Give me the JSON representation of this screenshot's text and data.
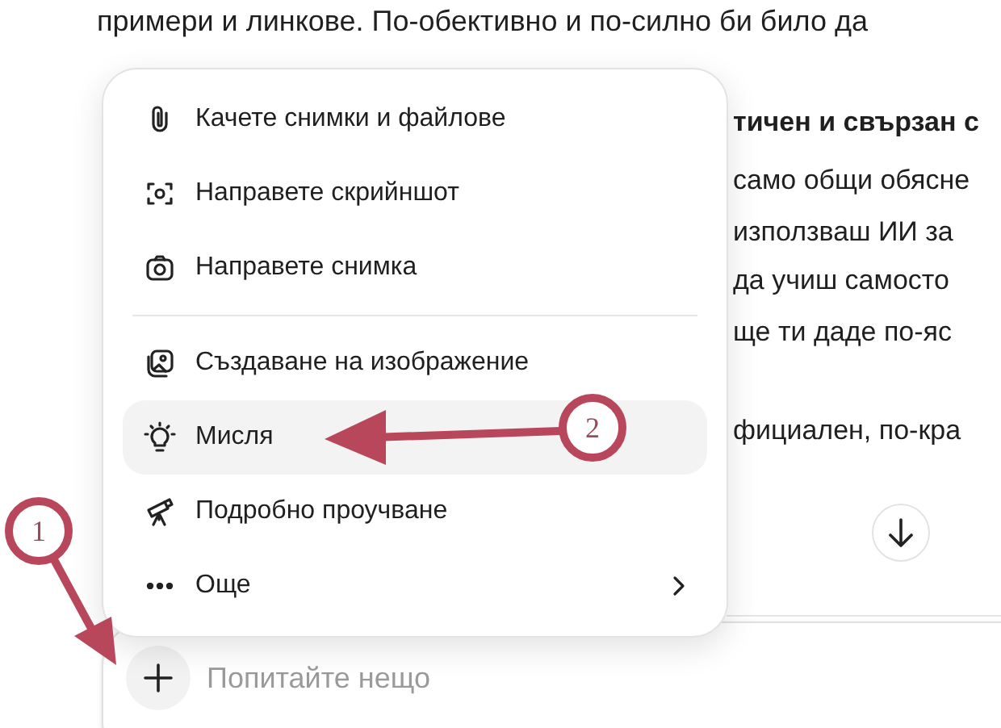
{
  "conversation": {
    "first_line": "примери и линкове. По-обективно и по-силно би било да",
    "fragments": [
      {
        "text": "тичен и свързан с",
        "bold": true
      },
      {
        "text": "само общи обясне",
        "bold": false
      },
      {
        "text": "използваш ИИ за",
        "bold": false
      },
      {
        "text": "да учиш самосто",
        "bold": false
      },
      {
        "text": "ще ти даде по-яс",
        "bold": false
      },
      {
        "text": "фициален, по-кра",
        "bold": false
      }
    ]
  },
  "menu": {
    "groups": [
      [
        {
          "label": "Качете снимки и файлове",
          "selected": false,
          "kind": "action"
        },
        {
          "label": "Направете скрийншот",
          "selected": false,
          "kind": "action"
        },
        {
          "label": "Направете снимка",
          "selected": false,
          "kind": "action"
        }
      ],
      [
        {
          "label": "Създаване на изображение",
          "selected": false,
          "kind": "action"
        },
        {
          "label": "Мисля",
          "selected": true,
          "kind": "action"
        },
        {
          "label": "Подробно проучване",
          "selected": false,
          "kind": "action"
        },
        {
          "label": "Още",
          "selected": false,
          "kind": "submenu"
        }
      ]
    ]
  },
  "composer": {
    "placeholder": "Попитайте нещо"
  },
  "annotations": [
    {
      "label": "1"
    },
    {
      "label": "2"
    }
  ]
}
